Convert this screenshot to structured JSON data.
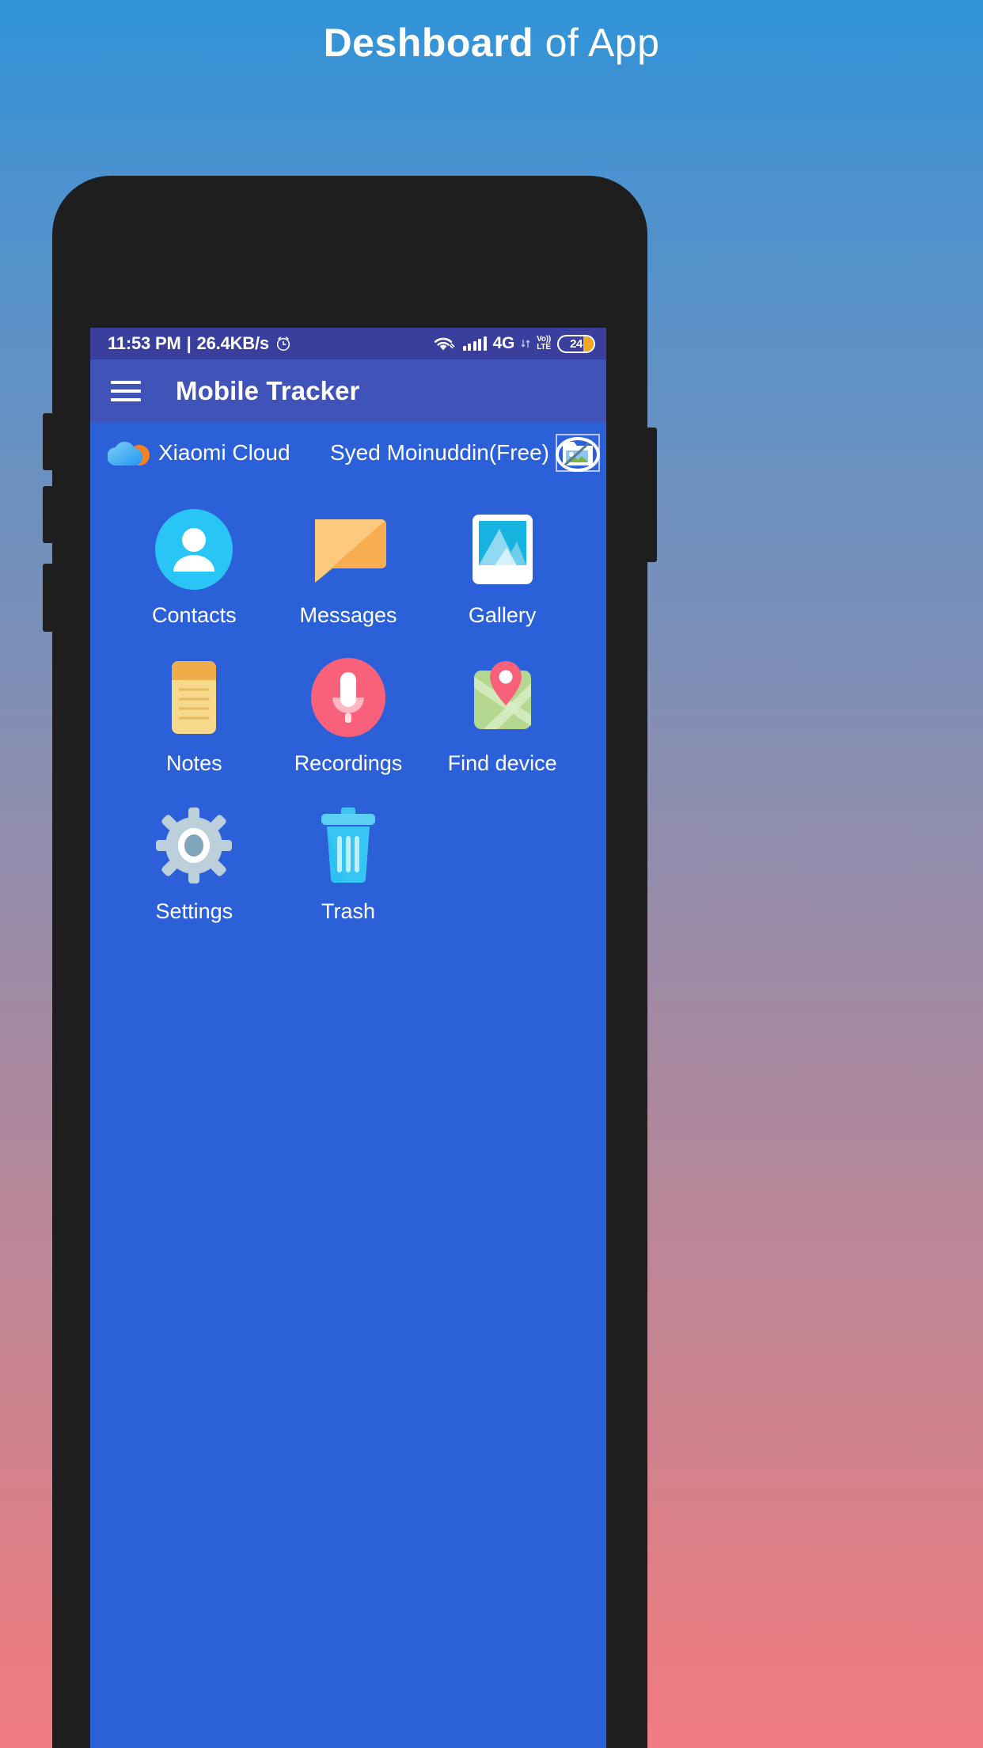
{
  "page": {
    "title_strong": "Deshboard",
    "title_light": " of App"
  },
  "phone": {
    "statusbar": {
      "time": "11:53 PM",
      "separator": "|",
      "network_speed": "26.4KB/s",
      "alarm_icon": "alarm-icon",
      "wifi_icon": "wifi-icon",
      "signal_icon": "signal-bars-icon",
      "network_type": "4G",
      "volte_top": "Vo))",
      "volte_bottom": "LTE",
      "battery_level": "24"
    },
    "appbar": {
      "menu_icon": "hamburger-menu-icon",
      "title": "Mobile Tracker"
    },
    "account": {
      "cloud_icon": "xiaomi-cloud-icon",
      "cloud_name": "Xiaomi Cloud",
      "user_name": "Syed Moinuddin(Free)",
      "avatar_icon": "broken-image-avatar-icon"
    },
    "grid": [
      {
        "label": "Contacts",
        "icon": "contacts-icon"
      },
      {
        "label": "Messages",
        "icon": "messages-icon"
      },
      {
        "label": "Gallery",
        "icon": "gallery-icon"
      },
      {
        "label": "Notes",
        "icon": "notes-icon"
      },
      {
        "label": "Recordings",
        "icon": "recordings-icon"
      },
      {
        "label": "Find device",
        "icon": "find-device-icon"
      },
      {
        "label": "Settings",
        "icon": "settings-icon"
      },
      {
        "label": "Trash",
        "icon": "trash-icon"
      }
    ]
  },
  "colors": {
    "bg_top": "#2f93d8",
    "bg_bottom": "#ef7c81",
    "device_body": "#1e1e1e",
    "screen_bg": "#2b60d8",
    "statusbar_bg": "#3a3f9e",
    "appbar_bg": "#4053b8",
    "battery_fill": "#f5a623"
  }
}
